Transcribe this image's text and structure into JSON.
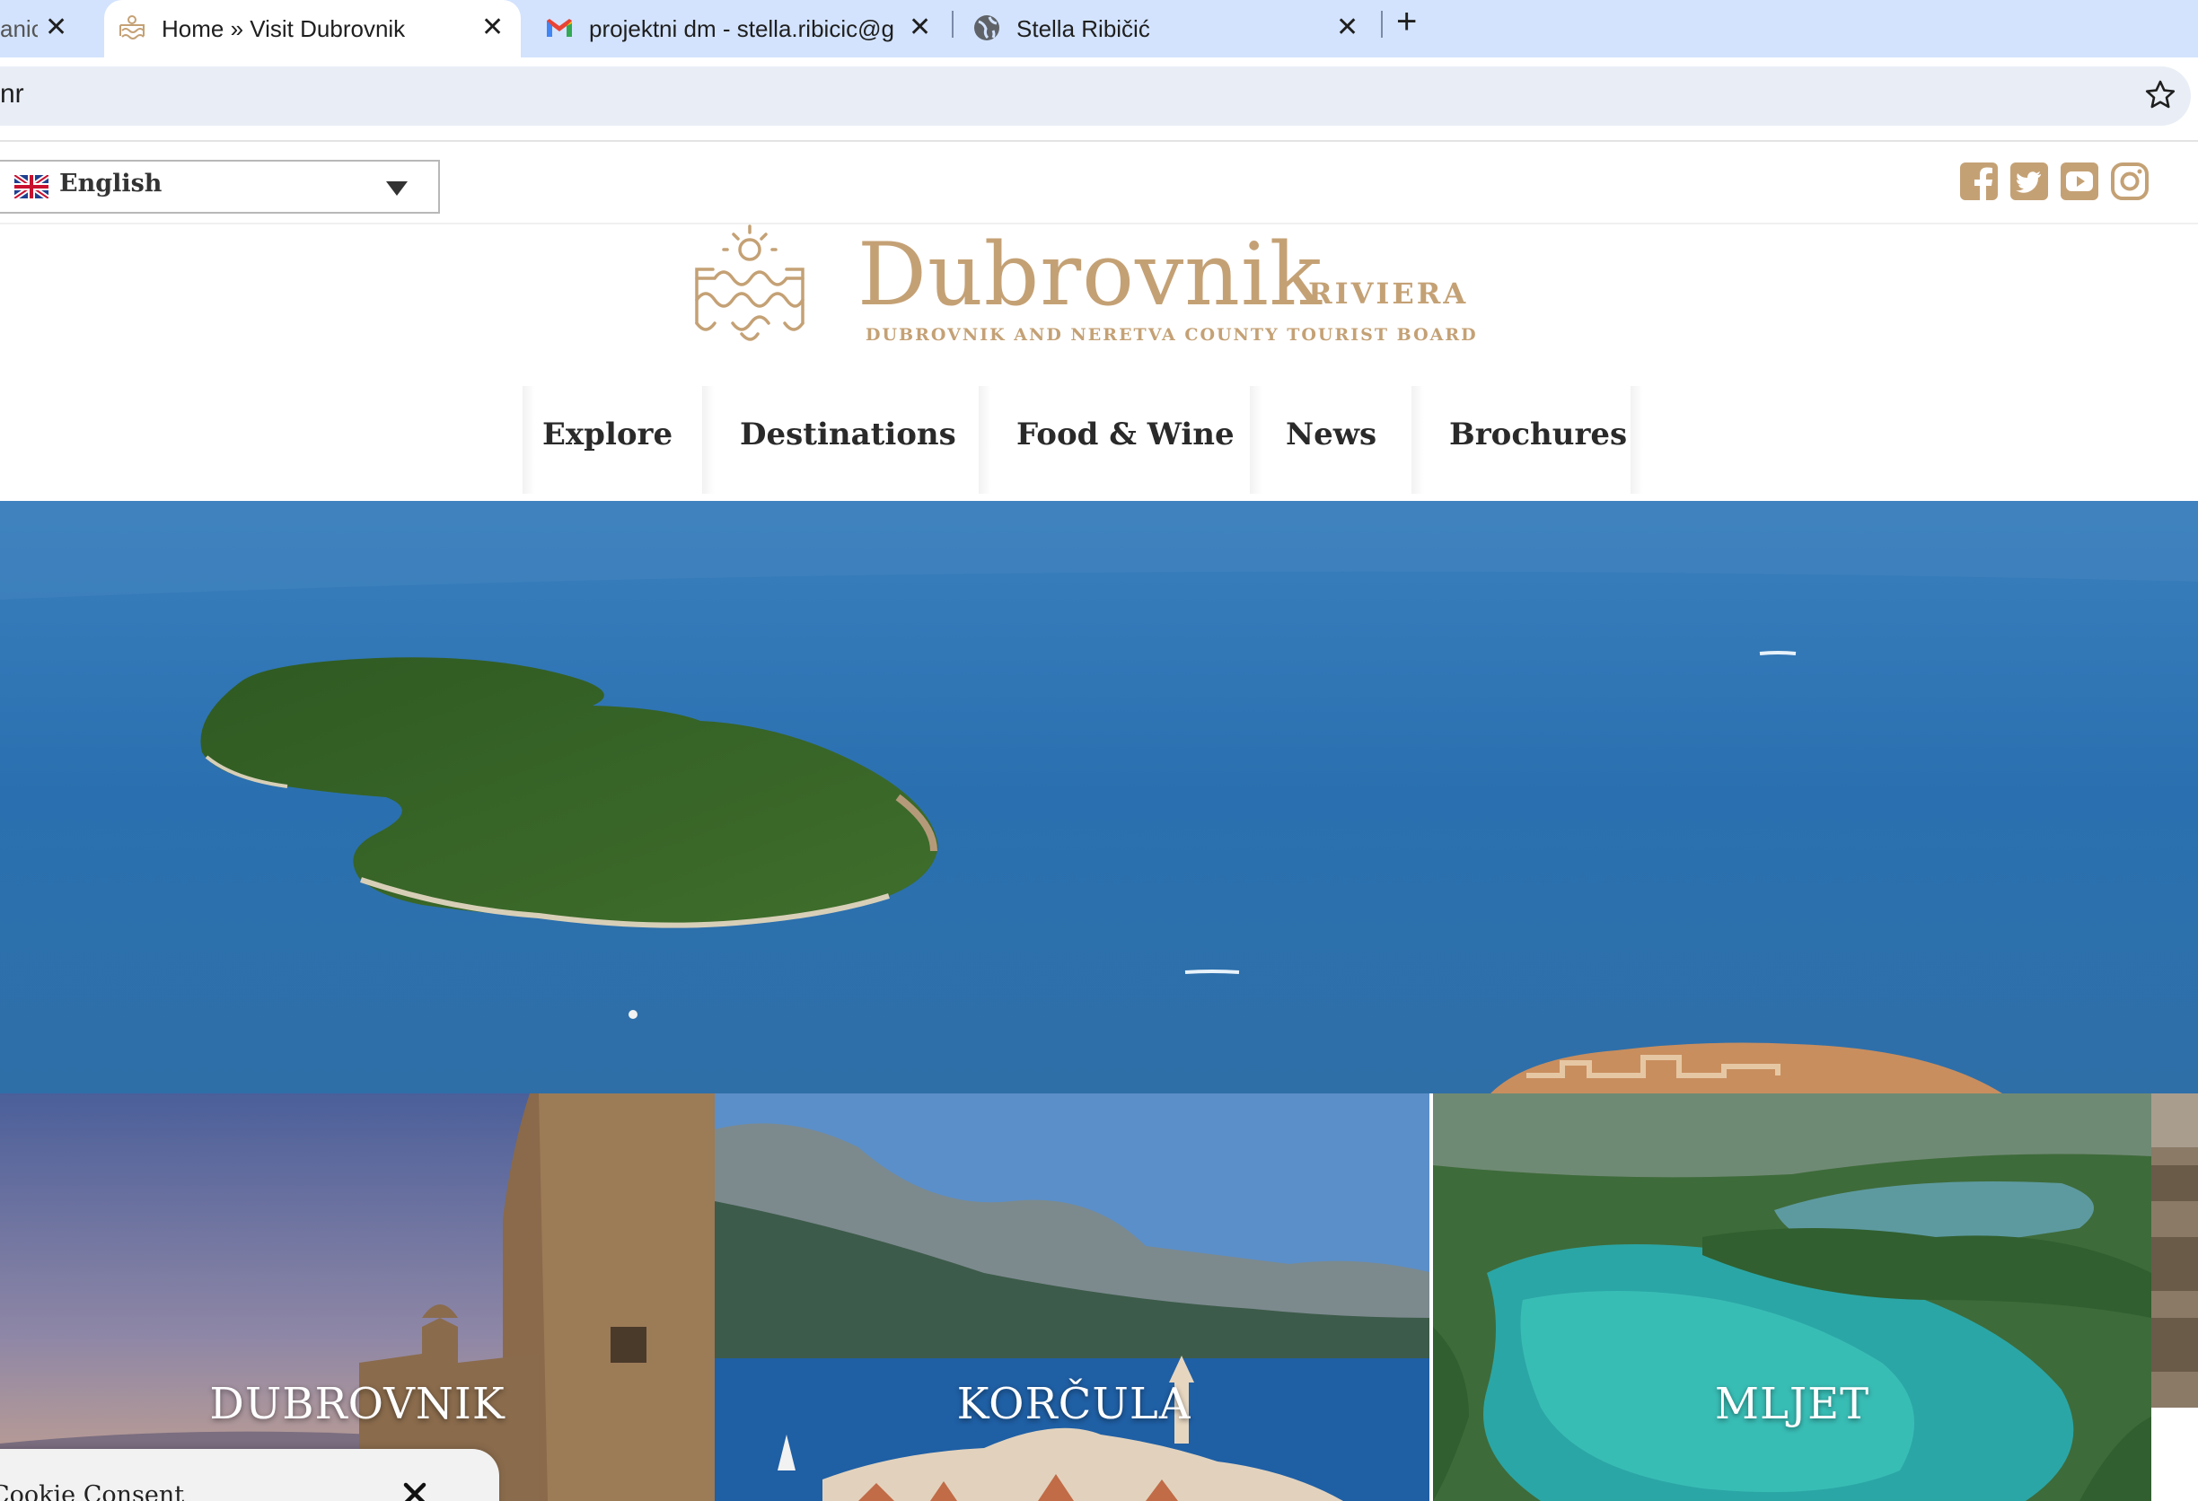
{
  "browser": {
    "tabs": [
      {
        "title": "anic",
        "active": false
      },
      {
        "title": "Home » Visit Dubrovnik",
        "active": true
      },
      {
        "title": "projektni dm - stella.ribicic@g",
        "active": false
      },
      {
        "title": "Stella Ribičić",
        "active": false
      }
    ],
    "address_text": "nr"
  },
  "language": {
    "selected": "English"
  },
  "social": [
    "facebook-icon",
    "twitter-icon",
    "youtube-icon",
    "instagram-icon"
  ],
  "logo": {
    "name": "Dubrovnik",
    "riviera": "RIVIERA",
    "subtitle": "DUBROVNIK AND NERETVA COUNTY TOURIST BOARD"
  },
  "nav": {
    "items": [
      "Explore",
      "Destinations",
      "Food & Wine",
      "News",
      "Brochures"
    ]
  },
  "destinations": [
    {
      "title": "DUBROVNIK"
    },
    {
      "title": "KORČULA"
    },
    {
      "title": "MLJET"
    }
  ],
  "cookie": {
    "title": "Cookie Consent"
  },
  "colors": {
    "brand_gold": "#c4a175",
    "sea": "#2f74b0"
  }
}
